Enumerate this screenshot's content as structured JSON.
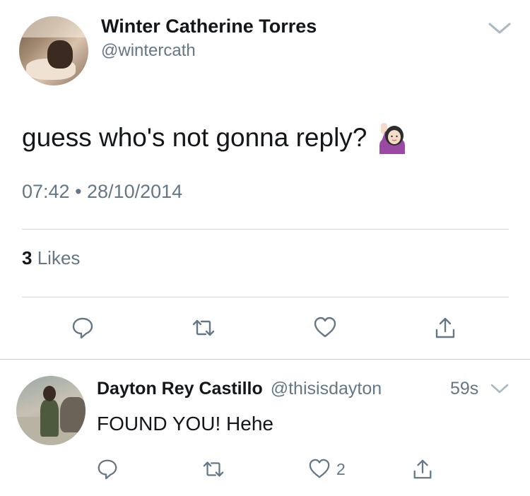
{
  "main_tweet": {
    "author_name": "Winter Catherine Torres",
    "author_handle": "@wintercath",
    "text": "guess who's not gonna reply?",
    "emoji": "raising-hand-woman-emoji",
    "timestamp": "07:42 • 28/10/2014",
    "likes": {
      "count": "3",
      "label": "Likes"
    },
    "actions": [
      "reply-icon",
      "retweet-icon",
      "heart-icon",
      "share-icon"
    ]
  },
  "reply": {
    "author_name": "Dayton Rey Castillo",
    "author_handle": "@thisisdayton",
    "time": "59s",
    "text": "FOUND YOU! Hehe",
    "like_count": "2",
    "actions": [
      "reply-icon",
      "retweet-icon",
      "heart-icon",
      "share-icon"
    ]
  },
  "colors": {
    "primary_text": "#14171a",
    "secondary_text": "#657786",
    "divider": "#cfd9de",
    "icon": "#657786",
    "background": "#ffffff"
  }
}
